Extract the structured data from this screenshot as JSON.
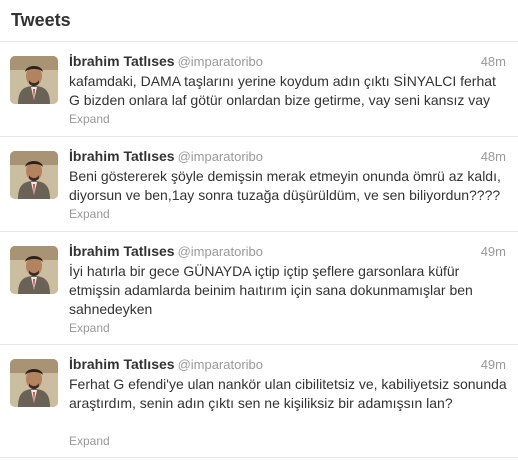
{
  "header": {
    "title": "Tweets"
  },
  "tweets": [
    {
      "fullname": "İbrahim Tatlıses",
      "screenname": "@imparatoribo",
      "timestamp": "48m",
      "text": "kafamdaki, DAMA taşlarını yerine koydum adın çıktı SİNYALCI ferhat G bizden onlara laf götür onlardan bize getirme, vay seni kansız vay",
      "expand": "Expand"
    },
    {
      "fullname": "İbrahim Tatlıses",
      "screenname": "@imparatoribo",
      "timestamp": "48m",
      "text": "Beni göstererek şöyle demişsin merak etmeyin onunda ömrü az kaldı, diyorsun ve ben,1ay sonra tuzağa düşürüldüm, ve sen biliyordun????",
      "expand": "Expand"
    },
    {
      "fullname": "İbrahim Tatlıses",
      "screenname": "@imparatoribo",
      "timestamp": "49m",
      "text": "İyi hatırla bir gece GÜNAYDA içtip içtip şeflere garsonlara küfür etmişsin adamlarda beinim haıtırım için sana dokunmamışlar ben sahnedeyken",
      "expand": "Expand"
    },
    {
      "fullname": "İbrahim Tatlıses",
      "screenname": "@imparatoribo",
      "timestamp": "49m",
      "text": "Ferhat G efendi'ye ulan nankör ulan cibilitetsiz ve, kabiliyetsiz sonunda araştırdım, senin adın çıktı sen ne kişiliksiz bir adamışsın lan?",
      "expand": "Expand"
    }
  ]
}
